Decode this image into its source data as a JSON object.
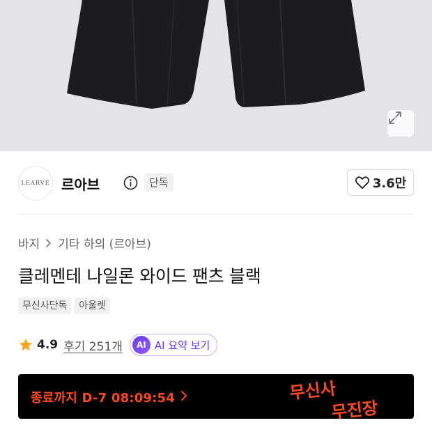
{
  "product_image": {
    "alt_icon": "pants-photo",
    "expand_icon": "expand-icon"
  },
  "brand": {
    "logo_text": "LEARVE",
    "name": "르아브",
    "info_icon": "info-icon",
    "badge": "단독"
  },
  "like": {
    "icon": "heart-icon",
    "count": "3.6만"
  },
  "breadcrumb": {
    "category": "바지",
    "separator_icon": "chevron-right-icon",
    "subcategory": "기타 하의 (르아브)"
  },
  "product": {
    "title": "클레멘테 나일론 와이드 팬츠 블랙",
    "tags": [
      "무신사단독",
      "아울렛"
    ]
  },
  "rating": {
    "star_icon": "star-icon",
    "score": "4.9",
    "reviews": "후기 251개",
    "ai_badge": "AI",
    "ai_label": "AI 요약 보기"
  },
  "promo": {
    "countdown": "종료까지 D-7 08:09:54",
    "chevron_icon": "chevron-right-icon",
    "logo_line1": "무신사",
    "logo_line2": "무진장",
    "background": "#000000",
    "accent": "#ff4a1f"
  },
  "colors": {
    "ai_purple": "#6a35e8",
    "star": "#f5a623"
  }
}
